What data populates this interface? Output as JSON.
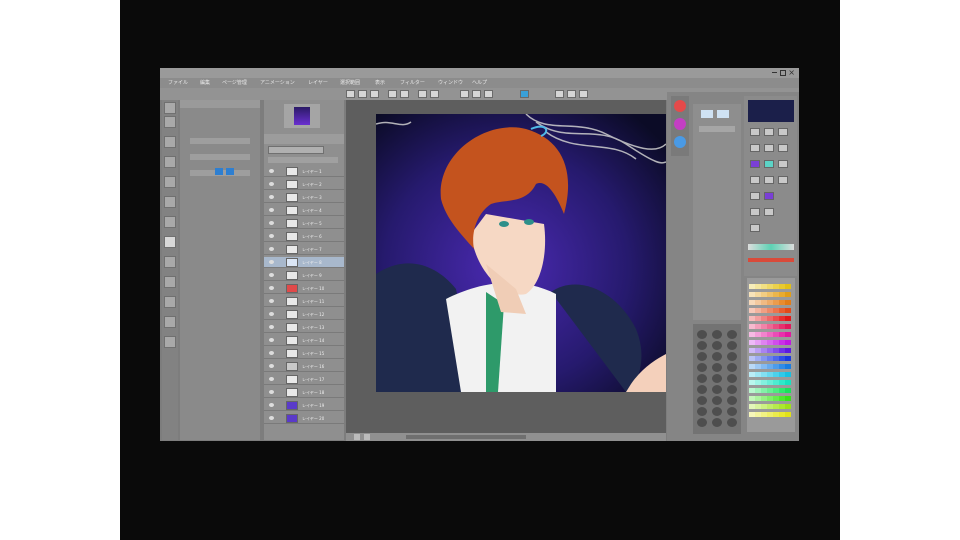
{
  "menu": {
    "items": [
      "ファイル",
      "編集",
      "ページ管理",
      "アニメーション",
      "レイヤー",
      "選択範囲",
      "表示",
      "フィルター",
      "ウィンドウ",
      "ヘルプ"
    ]
  },
  "layers": {
    "rows": [
      {
        "name": "レイヤー 1"
      },
      {
        "name": "レイヤー 2"
      },
      {
        "name": "レイヤー 3"
      },
      {
        "name": "レイヤー 4"
      },
      {
        "name": "レイヤー 5"
      },
      {
        "name": "レイヤー 6"
      },
      {
        "name": "レイヤー 7"
      },
      {
        "name": "レイヤー 8"
      },
      {
        "name": "レイヤー 9"
      },
      {
        "name": "レイヤー 10"
      },
      {
        "name": "レイヤー 11"
      },
      {
        "name": "レイヤー 12"
      },
      {
        "name": "レイヤー 13"
      },
      {
        "name": "レイヤー 14"
      },
      {
        "name": "レイヤー 15"
      },
      {
        "name": "レイヤー 16"
      },
      {
        "name": "レイヤー 17"
      },
      {
        "name": "レイヤー 18"
      },
      {
        "name": "レイヤー 19"
      },
      {
        "name": "レイヤー 20"
      }
    ]
  },
  "colors": {
    "window_bg": "#7d7d7d",
    "canvas_bg": "#5e5e5e",
    "hair": "#c4531e",
    "suit": "#1f2a4d",
    "tie": "#2e9a6a",
    "background_gradient_top": "#0b0b26",
    "background_gradient_bottom": "#4b2ab3"
  }
}
